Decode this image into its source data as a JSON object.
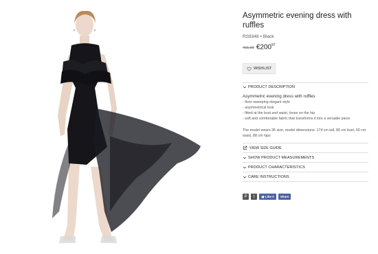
{
  "product": {
    "title": "Asymmetric evening dress with ruffles",
    "sku": "RS9348",
    "separator": "•",
    "color": "Black",
    "old_price": "401.99",
    "new_price_main": "€200",
    "new_price_cents": "97"
  },
  "wishlist": {
    "label": "WISHLIST",
    "icon": "heart-outline-icon"
  },
  "description": {
    "heading": "PRODUCT DESCRIPTION",
    "title": "Asymmetric evening dress with ruffles",
    "bullets": [
      "floor-sweeping elegant style",
      "asymmetrical look",
      "fitted at the bust and waist, loose on the hip",
      "soft and comfortable fabric that transforms it into a versatile piece"
    ],
    "model_note": "The model wears 36 size, model dimensions: 174 cm tall, 86 cm bust, 60 cm waist, 88 cm hips"
  },
  "links": {
    "size_guide": "VIEW SIZE GUIDE",
    "measurements": "SHOW PRODUCT MEASUREMENTS",
    "characteristics": "PRODUCT CHARACTERISTICS",
    "care": "CARE INSTRUCTIONS"
  },
  "social": {
    "pinterest": "P",
    "twitter": "t",
    "like_label": "Like 0",
    "share_label": "Share"
  },
  "colors": {
    "dress": "#15151a",
    "skin": "#e8d3c5",
    "fb_blue": "#4b62a1"
  }
}
